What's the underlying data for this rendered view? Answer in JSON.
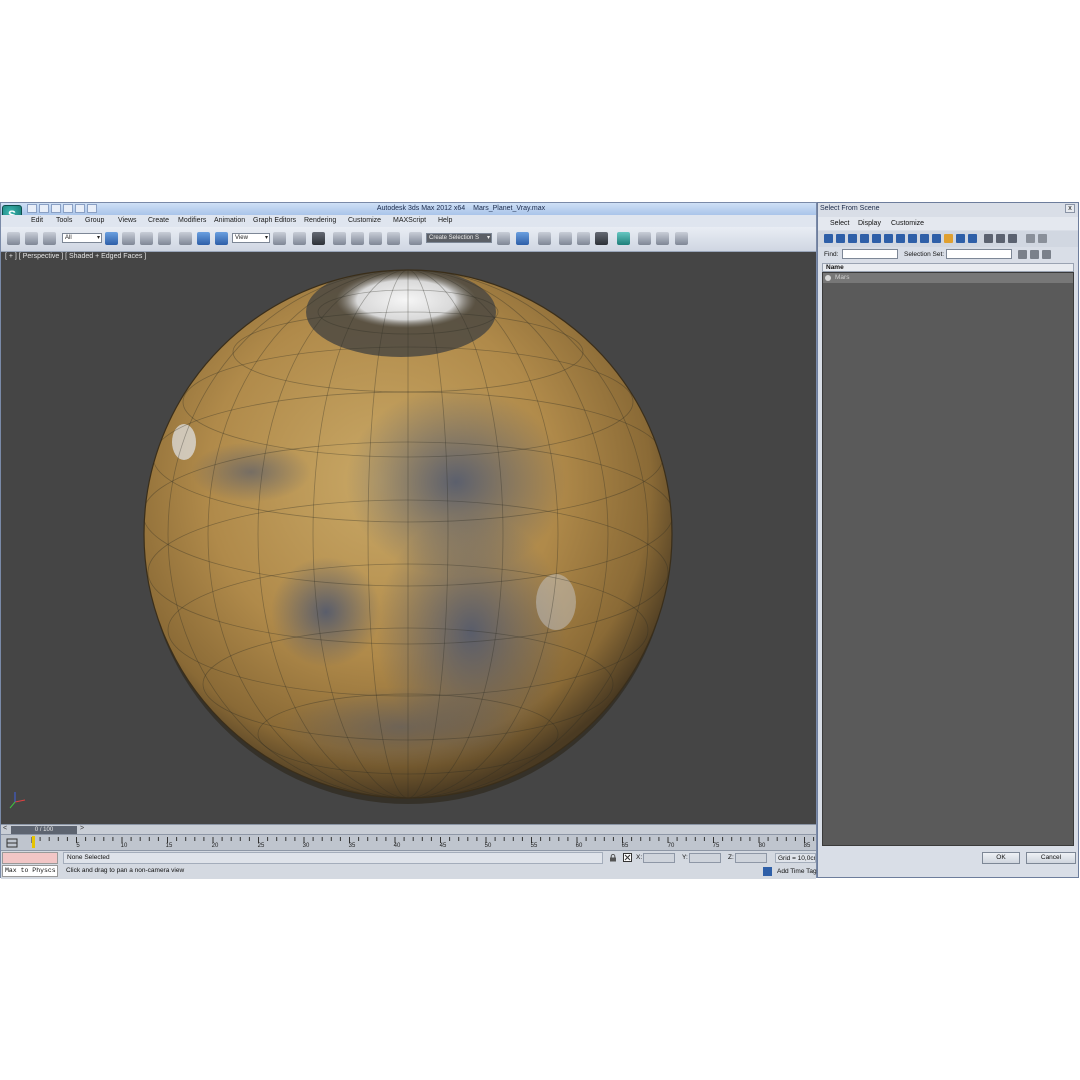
{
  "app": {
    "title": "Autodesk 3ds Max  2012 x64",
    "file": "Mars_Planet_Vray.max"
  },
  "menu": [
    "Edit",
    "Tools",
    "Group",
    "Views",
    "Create",
    "Modifiers",
    "Animation",
    "Graph Editors",
    "Rendering",
    "Customize",
    "MAXScript",
    "Help"
  ],
  "toolbar": {
    "filter_value": "All",
    "ref_coord_value": "View",
    "selection_set_value": "Create Selection S"
  },
  "viewport": {
    "label": "[ + ] [ Perspective ] [ Shaded + Edged Faces ]"
  },
  "timeline": {
    "frame_display": "0 / 100",
    "prev_label": "<",
    "next_label": ">",
    "ticks": [
      "5",
      "10",
      "15",
      "20",
      "25",
      "30",
      "35",
      "40",
      "45",
      "50",
      "55",
      "60",
      "65",
      "70",
      "75",
      "80",
      "85"
    ]
  },
  "status": {
    "maxscript_listener": "Max to Physcs",
    "selection": "None Selected",
    "prompt": "Click and drag to pan a non-camera view",
    "x_label": "X:",
    "y_label": "Y:",
    "z_label": "Z:",
    "grid": "Grid = 10,0cm",
    "add_time_tag": "Add Time Tag"
  },
  "dialog": {
    "title": "Select From Scene",
    "close_label": "x",
    "menu": [
      "Select",
      "Display",
      "Customize"
    ],
    "find_label": "Find:",
    "selection_set_label": "Selection Set:",
    "column_name": "Name",
    "items": [
      {
        "name": "Mars"
      }
    ],
    "ok_label": "OK",
    "cancel_label": "Cancel"
  },
  "colors": {
    "viewport_bg": "#454545",
    "planet_base": "#b08a4a",
    "polar_cap": "#ececec",
    "accent_blue": "#2e5fa8"
  }
}
